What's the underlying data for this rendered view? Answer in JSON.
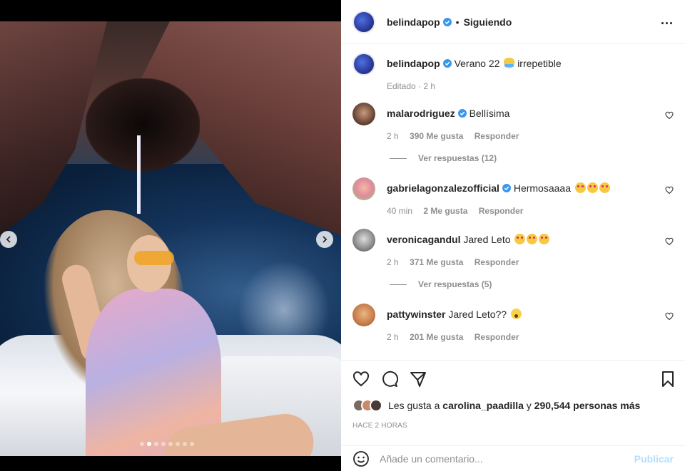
{
  "post": {
    "username": "belindapop",
    "follow_state": "Siguiendo",
    "separator": "•"
  },
  "media": {
    "slide_count": 8,
    "active_slide": 2
  },
  "caption": {
    "username": "belindapop",
    "text": "Verano 22",
    "emoji": "smiling-face-with-open-hands",
    "text_after": "irrepetible",
    "meta": "Editado · 2 h"
  },
  "comments": [
    {
      "username": "malarodriguez",
      "verified": true,
      "text": "Bellísima",
      "time": "2 h",
      "likes": "390 Me gusta",
      "reply": "Responder",
      "view_replies": "Ver respuestas (12)"
    },
    {
      "username": "gabrielagonzalezofficial",
      "verified": true,
      "text": "Hermosaaaa",
      "emojis": 3,
      "time": "40 min",
      "likes": "2 Me gusta",
      "reply": "Responder"
    },
    {
      "username": "veronicagandul",
      "verified": false,
      "text": "Jared Leto",
      "emojis": 3,
      "time": "2 h",
      "likes": "371 Me gusta",
      "reply": "Responder",
      "view_replies": "Ver respuestas (5)"
    },
    {
      "username": "pattywinster",
      "verified": false,
      "text": "Jared Leto??",
      "time": "2 h",
      "likes": "201 Me gusta",
      "reply": "Responder"
    }
  ],
  "likes": {
    "prefix": "Les gusta a",
    "user": "carolina_paadilla",
    "joiner": "y",
    "count": "290,544 personas más"
  },
  "time_ago": "HACE 2 HORAS",
  "add_comment": {
    "placeholder": "Añade un comentario...",
    "publish": "Publicar"
  },
  "colors": {
    "verified_blue": "#3897f0",
    "publish_disabled": "#b2dffc",
    "meta_gray": "#8e8e8e"
  }
}
